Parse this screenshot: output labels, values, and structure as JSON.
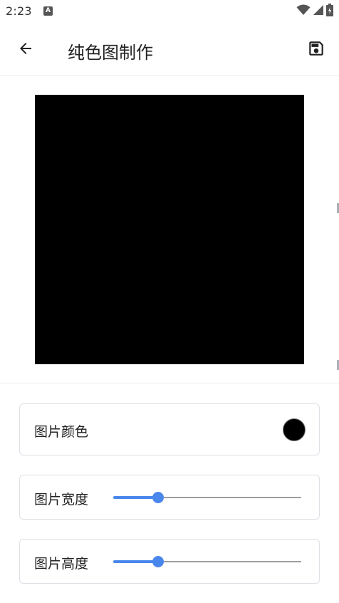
{
  "status_bar": {
    "time": "2:23",
    "notification_badge": "A",
    "icons": [
      "wifi-icon",
      "signal-icon",
      "battery-icon"
    ]
  },
  "app_bar": {
    "title": "纯色图制作",
    "back_icon": "arrow-left-icon",
    "save_icon": "save-icon"
  },
  "preview": {
    "fill_color": "#000000"
  },
  "settings": {
    "color": {
      "label": "图片颜色",
      "value": "#000000"
    },
    "width": {
      "label": "图片宽度",
      "fraction": 0.24
    },
    "height": {
      "label": "图片高度",
      "fraction": 0.24
    }
  },
  "colors": {
    "accent": "#4a87ec",
    "track": "#9e9e9e",
    "card_border": "#dde0e5"
  }
}
